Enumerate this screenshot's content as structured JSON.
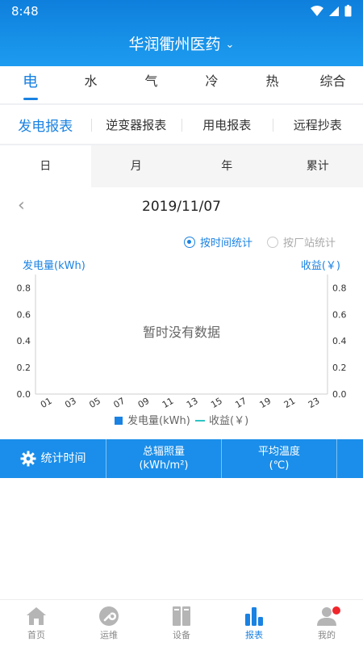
{
  "status_bar": {
    "time": "8:48"
  },
  "header": {
    "title": "华润衢州医药"
  },
  "energy_tabs": [
    {
      "label": "电",
      "active": true
    },
    {
      "label": "水",
      "active": false
    },
    {
      "label": "气",
      "active": false
    },
    {
      "label": "冷",
      "active": false
    },
    {
      "label": "热",
      "active": false
    },
    {
      "label": "综合",
      "active": false
    }
  ],
  "report_tabs": [
    {
      "label": "发电报表",
      "active": true
    },
    {
      "label": "逆变器报表",
      "active": false
    },
    {
      "label": "用电报表",
      "active": false
    },
    {
      "label": "远程抄表",
      "active": false
    }
  ],
  "period_tabs": [
    {
      "label": "日",
      "active": true
    },
    {
      "label": "月",
      "active": false
    },
    {
      "label": "年",
      "active": false
    },
    {
      "label": "累计",
      "active": false
    }
  ],
  "date": {
    "value": "2019/11/07"
  },
  "stat_mode": {
    "by_time": "按时间统计",
    "by_station": "按厂站统计",
    "selected": "by_time"
  },
  "chart_data": {
    "type": "bar",
    "ylabel_left": "发电量(kWh)",
    "ylabel_right": "收益(￥)",
    "empty_text": "暂时没有数据",
    "x_ticks": [
      "01",
      "03",
      "05",
      "07",
      "09",
      "11",
      "13",
      "15",
      "17",
      "19",
      "21",
      "23"
    ],
    "y_ticks_left": [
      "0.0",
      "0.2",
      "0.4",
      "0.6",
      "0.8"
    ],
    "y_ticks_right": [
      "0.0",
      "0.2",
      "0.4",
      "0.6",
      "0.8"
    ],
    "ylim": [
      0,
      0.9
    ],
    "series": [
      {
        "name": "发电量(kWh)",
        "values": []
      },
      {
        "name": "收益(￥)",
        "values": []
      }
    ],
    "colors": {
      "bar": "#1a82e2",
      "line": "#2ec4c4"
    }
  },
  "summary": {
    "col1": "统计时间",
    "col2_line1": "总辐照量",
    "col2_line2": "(kWh/m²)",
    "col3_line1": "平均温度",
    "col3_line2": "(℃)"
  },
  "bottom_nav": [
    {
      "label": "首页",
      "icon": "home-icon",
      "active": false
    },
    {
      "label": "运维",
      "icon": "wrench-icon",
      "active": false
    },
    {
      "label": "设备",
      "icon": "device-icon",
      "active": false
    },
    {
      "label": "报表",
      "icon": "report-icon",
      "active": true
    },
    {
      "label": "我的",
      "icon": "user-icon",
      "active": false
    }
  ],
  "colors": {
    "primary": "#1a82e2",
    "header": "#1d9cf0",
    "badge": "#f0262c"
  }
}
